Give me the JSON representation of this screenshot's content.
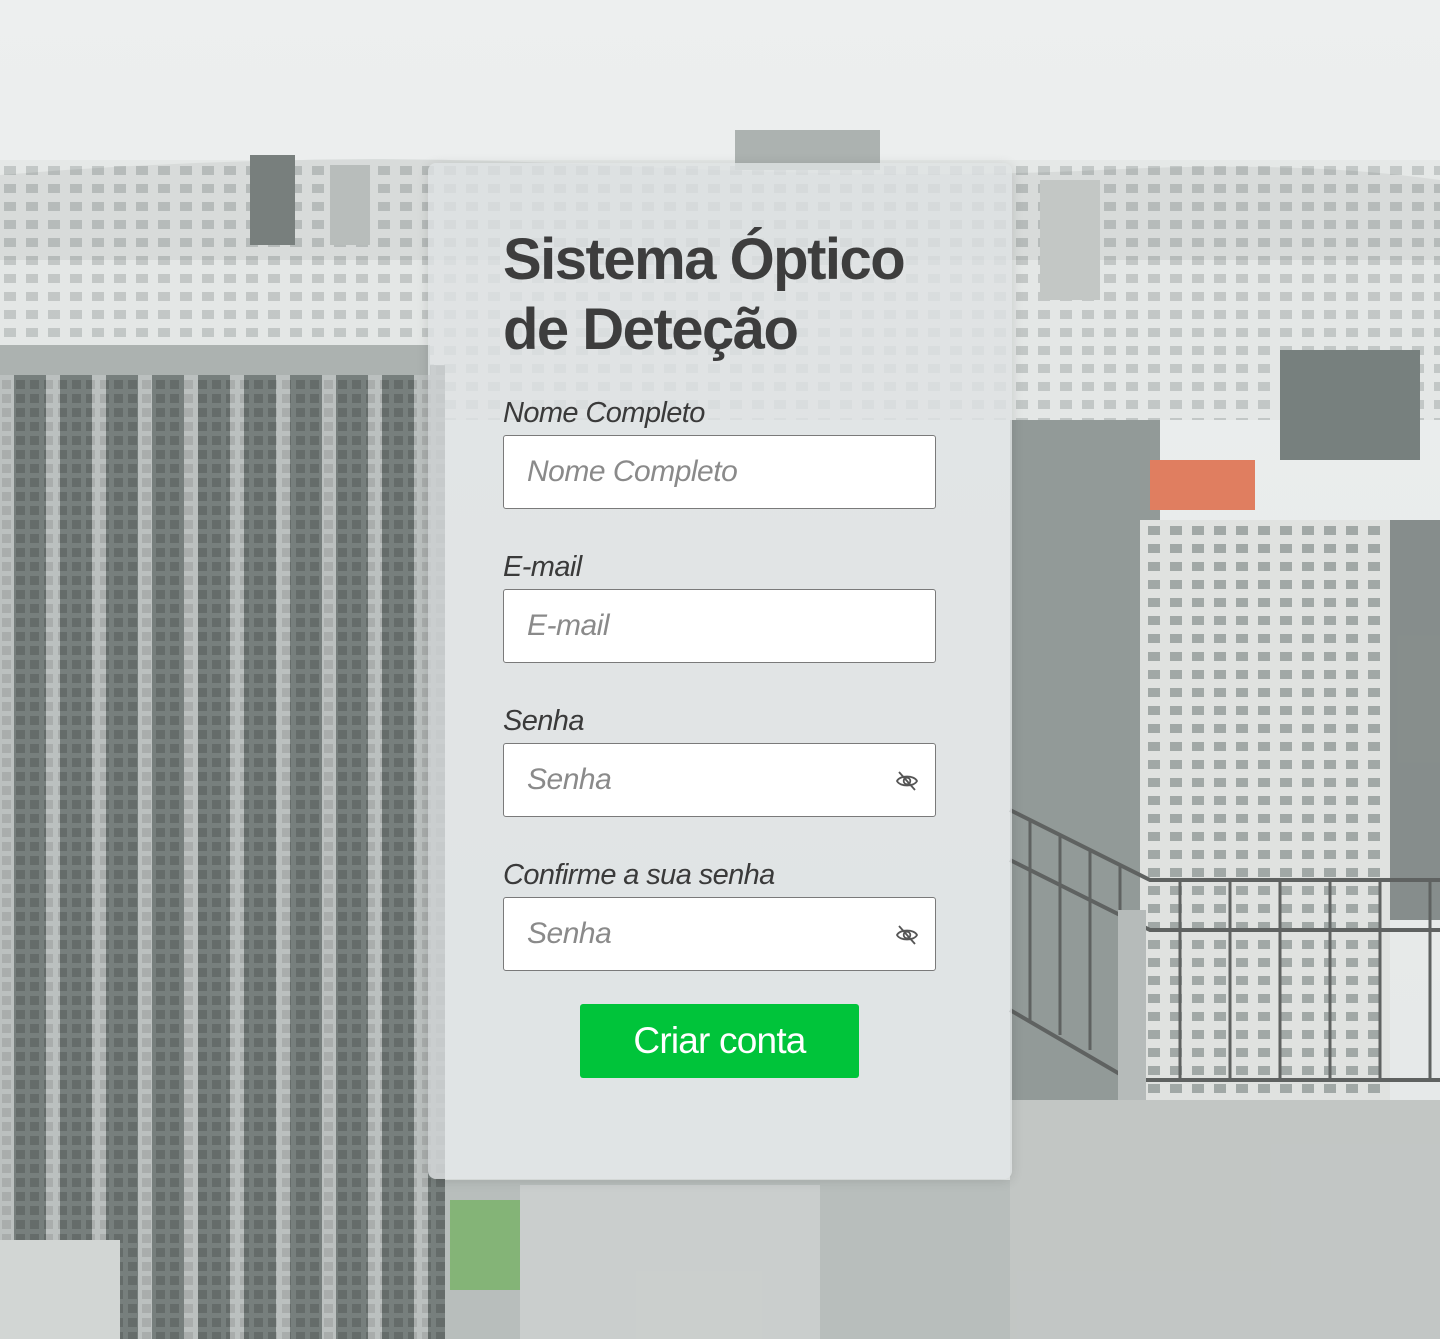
{
  "colors": {
    "accent": "#00c43a",
    "title": "#3d3d3d",
    "card": "#dee2e4"
  },
  "form": {
    "title": "Sistema Óptico de Deteção",
    "fields": {
      "name": {
        "label": "Nome Completo",
        "placeholder": "Nome Completo",
        "value": ""
      },
      "email": {
        "label": "E-mail",
        "placeholder": "E-mail",
        "value": ""
      },
      "password": {
        "label": "Senha",
        "placeholder": "Senha",
        "value": "",
        "icon": "eye-slash-icon"
      },
      "confirm": {
        "label": "Confirme a sua senha",
        "placeholder": "Senha",
        "value": "",
        "icon": "eye-slash-icon"
      }
    },
    "submit_label": "Criar conta"
  },
  "background": {
    "description_icon": "city-skyline-photo"
  }
}
